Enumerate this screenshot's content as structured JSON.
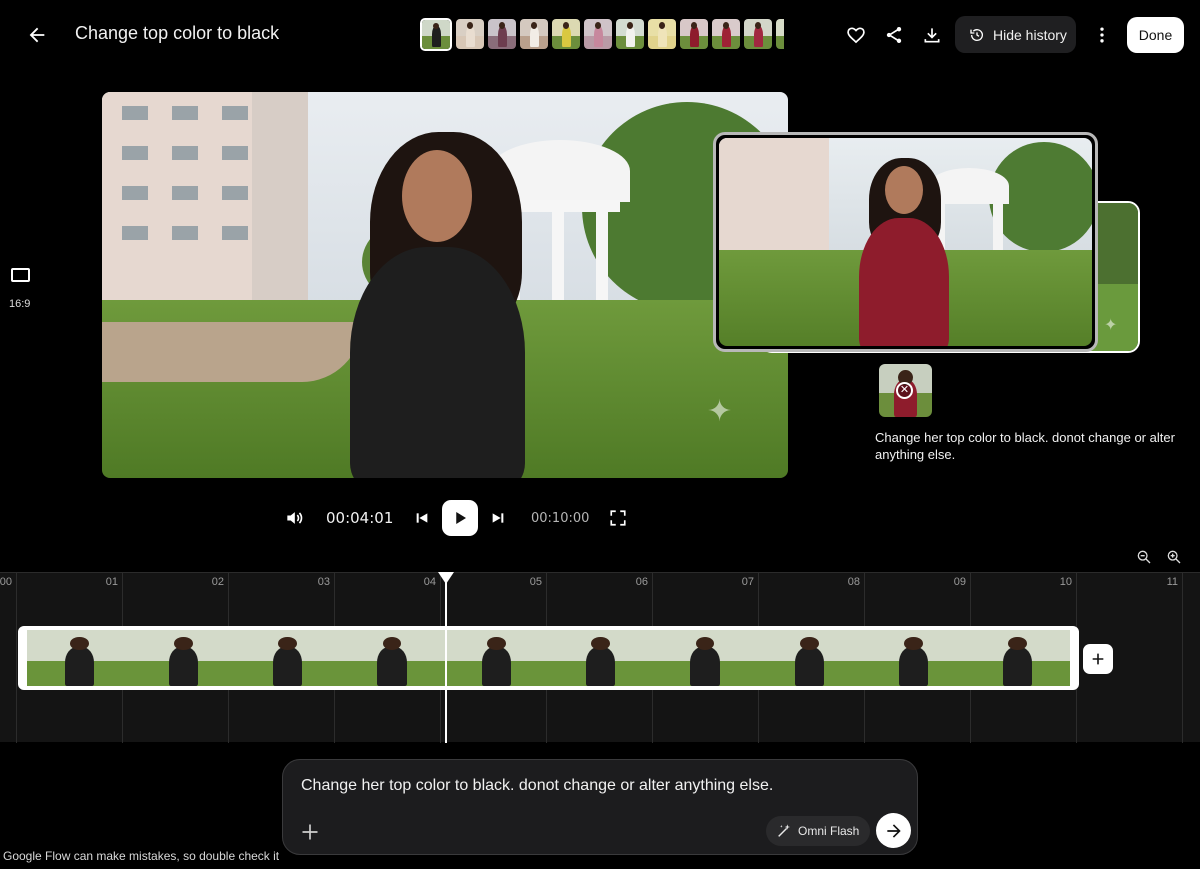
{
  "header": {
    "title": "Change top color to black",
    "hide_history_label": "Hide history",
    "done_label": "Done"
  },
  "aspect_ratio": {
    "label": "16:9"
  },
  "history": {
    "prompt": "Change her top color to black. donot change or alter anything else."
  },
  "player": {
    "current_time": "00:04:01",
    "duration": "00:10:00"
  },
  "timeline": {
    "ticks": [
      "00",
      "01",
      "02",
      "03",
      "04",
      "05",
      "06",
      "07",
      "08",
      "09",
      "10",
      "11"
    ],
    "playhead_seconds": 4.1
  },
  "composer": {
    "prompt_text": "Change her top color to black. donot change or alter anything else.",
    "model_label": "Omni Flash"
  },
  "footer": {
    "disclaimer": "Google Flow can make mistakes, so double check it"
  },
  "colors": {
    "background": "#000000",
    "panel": "#1c1c1e",
    "accent": "#ffffff",
    "black_top": "#1e1e1e",
    "red_top": "#8e1c2c"
  }
}
